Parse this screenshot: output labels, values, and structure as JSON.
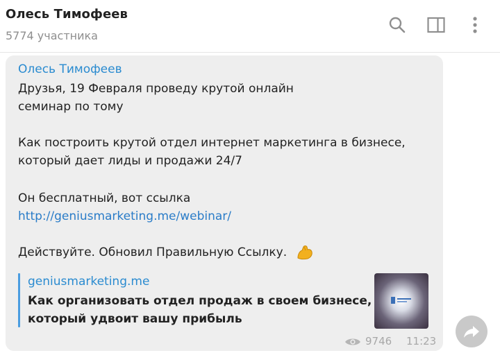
{
  "header": {
    "title": "Олесь Тимофеев",
    "subtitle": "5774 участника",
    "icons": [
      "search-icon",
      "sidebar-toggle-icon",
      "more-vertical-icon"
    ]
  },
  "message": {
    "sender": "Олесь Тимофеев",
    "lines": [
      "Друзья, 19 Февраля проведу крутой онлайн",
      "семинар по тому",
      "Как построить крутой отдел интернет маркетинга в бизнесе,",
      "который дает лиды и продажи 24/7",
      "Он бесплатный, вот ссылка"
    ],
    "link": "http://geniusmarketing.me/webinar/",
    "last_line": "Действуйте. Обновил Правильную Ссылку.",
    "emoji": "flexed-biceps-emoji",
    "preview": {
      "site": "geniusmarketing.me",
      "title_line1": "Как организовать отдел продаж в своем бизнесе,",
      "title_line2": "который удвоит вашу прибыль"
    },
    "views": "9746",
    "time": "11:23"
  },
  "colors": {
    "accent": "#2a8bd0",
    "bubble": "#eeeeee",
    "meta": "#a8a8a8"
  }
}
